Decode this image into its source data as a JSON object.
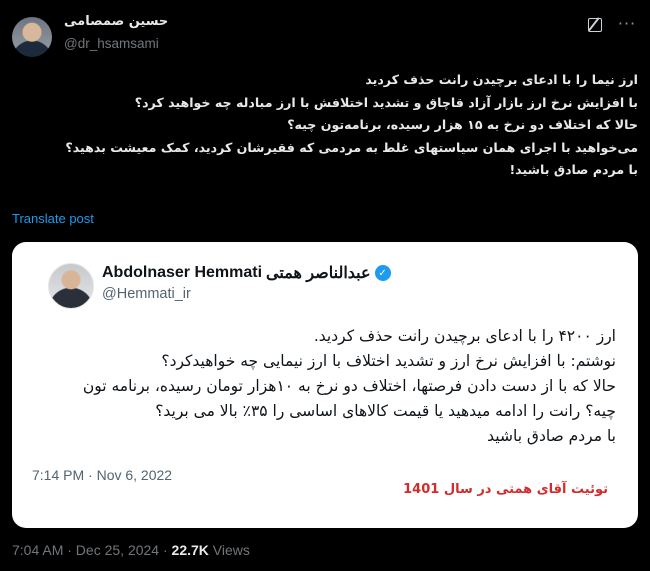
{
  "author": {
    "name": "حسین صمصامی",
    "handle": "@dr_hsamsami"
  },
  "header_icons": [
    "grok-icon",
    "more-options-icon"
  ],
  "tweet": {
    "lines": [
      "ارز نیما را با ادعای برچیدن رانت حذف کردید",
      "با افزایش نرخ ارز بازار آزاد قاچاق و تشدید اختلافش با ارز مبادله چه خواهید کرد؟",
      "حالا که اختلاف دو نرخ به ۱۵ هزار رسیده، برنامه‌تون چیه؟",
      "می‌خواهید با اجرای همان سیاستهای غلط به مردمی که فقیرشان کردید، کمک معیشت بدهید؟",
      "با مردم صادق باشید!"
    ],
    "translate_label": "Translate post"
  },
  "quote": {
    "name_persian": "عبدالناصر همتی",
    "name_latin": "Abdolnaser Hemmati",
    "handle": "@Hemmati_ir",
    "lines": [
      "ارز ۴۲۰۰ را با ادعای برچیدن رانت حذف کردید.",
      "نوشتم: با افزایش نرخ ارز و تشدید اختلاف با ارز نیمایی چه خواهیدکرد؟",
      "حالا که با از دست دادن فرصتها، اختلاف دو نرخ به ۱۰هزار تومان رسیده، برنامه تون",
      "چیه؟ رانت را ادامه میدهید یا قیمت کالاهای اساسی را ۳۵٪ بالا می برید؟",
      "با مردم صادق باشید"
    ],
    "timestamp": "7:14 PM · Nov 6, 2022",
    "caption": "توئیت آقای همتی در سال 1401"
  },
  "meta": {
    "timestamp": "7:04 AM · Dec 25, 2024 · ",
    "views_count": "22.7K",
    "views_label": " Views"
  },
  "colors": {
    "background": "#000000",
    "link": "#1d9bf0",
    "caption": "#d32b2b",
    "card": "#ffffff"
  }
}
